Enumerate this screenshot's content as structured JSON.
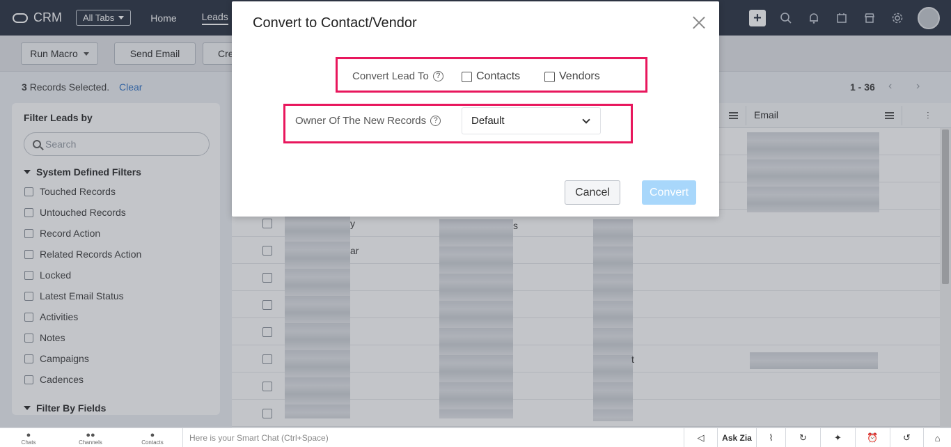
{
  "topbar": {
    "app_name": "CRM",
    "all_tabs_label": "All Tabs",
    "nav": [
      "Home",
      "Leads"
    ]
  },
  "toolbar": {
    "run_macro": "Run Macro",
    "send_email": "Send Email",
    "create_partial": "Cre"
  },
  "records": {
    "count": "3",
    "selected_text": "Records Selected.",
    "clear": "Clear",
    "pager": "1 - 36"
  },
  "sidebar": {
    "title": "Filter Leads by",
    "search_placeholder": "Search",
    "system_group": "System Defined Filters",
    "items": [
      "Touched Records",
      "Untouched Records",
      "Record Action",
      "Related Records Action",
      "Locked",
      "Latest Email Status",
      "Activities",
      "Notes",
      "Campaigns",
      "Cadences"
    ],
    "fields_group": "Filter By Fields"
  },
  "grid": {
    "email_header": "Email",
    "fragments": [
      "y",
      "s",
      "ar",
      "t"
    ]
  },
  "modal": {
    "title": "Convert to Contact/Vendor",
    "convert_lead_to": "Convert Lead To",
    "contacts": "Contacts",
    "vendors": "Vendors",
    "owner_label": "Owner Of The New Records",
    "owner_value": "Default",
    "help_glyph": "?",
    "cancel": "Cancel",
    "convert": "Convert"
  },
  "bottombar": {
    "chats": "Chats",
    "channels": "Channels",
    "contacts": "Contacts",
    "smart_chat": "Here is your Smart Chat (Ctrl+Space)",
    "ask_zia": "Ask Zia"
  },
  "colors": {
    "topbar": "#313949",
    "highlight": "#e8175d",
    "convert_disabled": "#a8d7fb",
    "link": "#3a79c8"
  }
}
